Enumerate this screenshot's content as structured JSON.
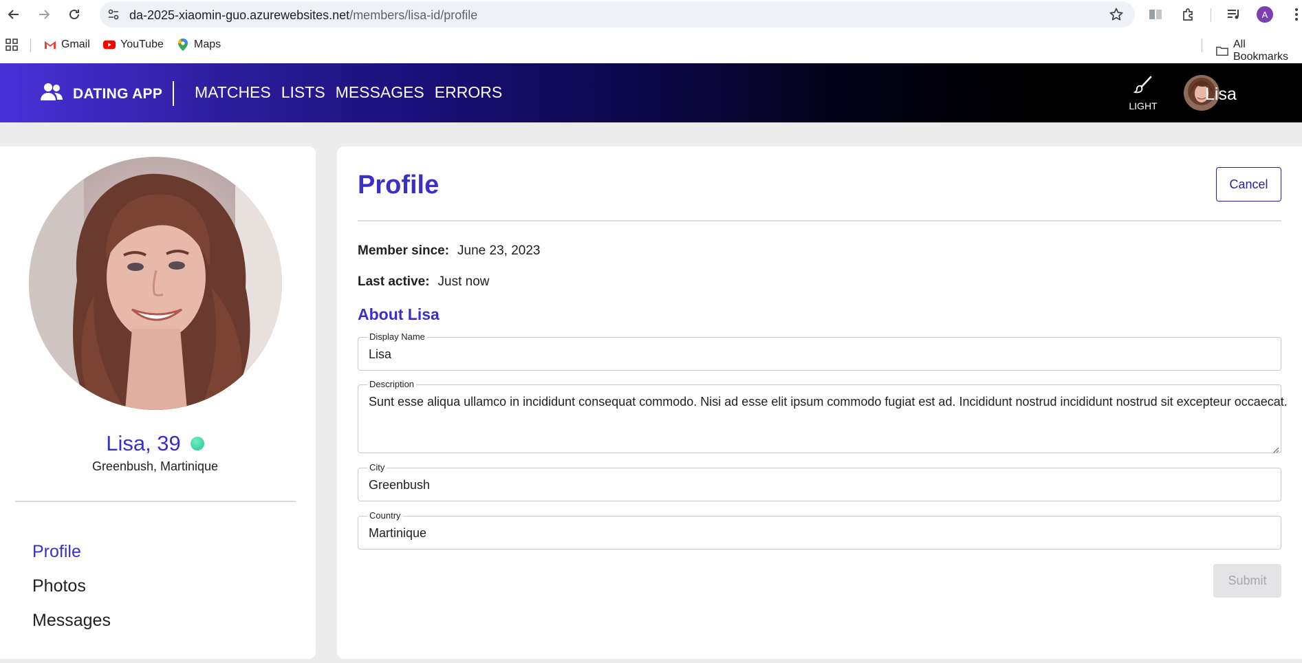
{
  "browser": {
    "url_host": "da-2025-xiaomin-guo.azurewebsites.net",
    "url_path": "/members/lisa-id/profile",
    "profile_initial": "A",
    "bookmarks": [
      {
        "label": "Gmail",
        "icon": "gmail-icon"
      },
      {
        "label": "YouTube",
        "icon": "youtube-icon"
      },
      {
        "label": "Maps",
        "icon": "maps-icon"
      }
    ],
    "all_bookmarks_label": "All Bookmarks"
  },
  "navbar": {
    "brand": "DATING APP",
    "links": [
      "MATCHES",
      "LISTS",
      "MESSAGES",
      "ERRORS"
    ],
    "theme_label": "LIGHT",
    "user_name": "Lisa"
  },
  "member": {
    "name_age": "Lisa, 39",
    "location": "Greenbush, Martinique",
    "online": true
  },
  "sidebar": {
    "items": [
      {
        "label": "Profile",
        "active": true
      },
      {
        "label": "Photos",
        "active": false
      },
      {
        "label": "Messages",
        "active": false
      }
    ]
  },
  "profile": {
    "title": "Profile",
    "cancel_label": "Cancel",
    "member_since_label": "Member since:",
    "member_since_value": "June 23, 2023",
    "last_active_label": "Last active:",
    "last_active_value": "Just now",
    "about_title": "About Lisa",
    "fields": {
      "display_name": {
        "label": "Display Name",
        "value": "Lisa"
      },
      "description": {
        "label": "Description",
        "value": "Sunt esse aliqua ullamco in incididunt consequat commodo. Nisi ad esse elit ipsum commodo fugiat est ad. Incididunt nostrud incididunt nostrud sit excepteur occaecat."
      },
      "city": {
        "label": "City",
        "value": "Greenbush"
      },
      "country": {
        "label": "Country",
        "value": "Martinique"
      }
    },
    "submit_label": "Submit"
  },
  "colors": {
    "accent": "#3b2fc9",
    "navbar_start": "#4931d8",
    "navbar_end": "#000000",
    "online": "#2fd39a"
  }
}
